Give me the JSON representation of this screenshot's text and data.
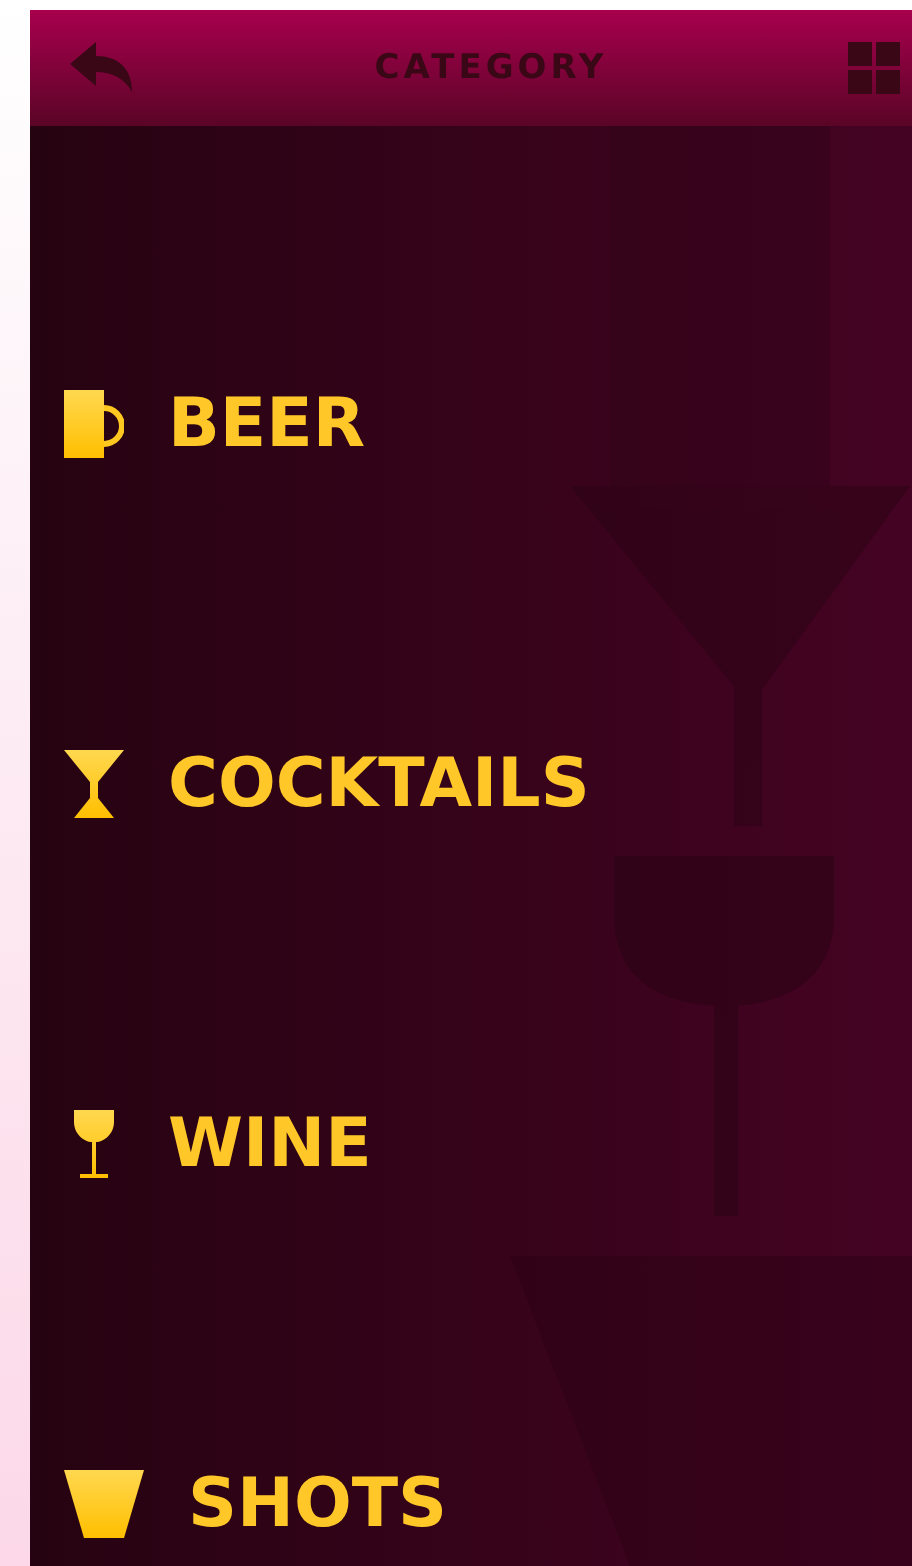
{
  "header": {
    "title": "CATEGORY"
  },
  "categories": [
    {
      "kind": "beer",
      "label": "BEER"
    },
    {
      "kind": "cocktail",
      "label": "COCKTAILS"
    },
    {
      "kind": "wine",
      "label": "WINE"
    },
    {
      "kind": "shot",
      "label": "SHOTS"
    }
  ]
}
